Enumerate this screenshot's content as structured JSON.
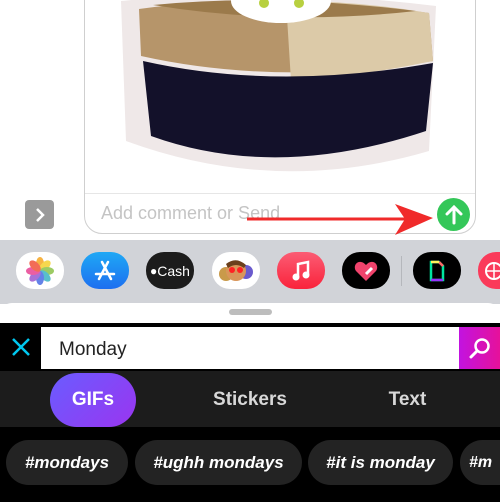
{
  "compose": {
    "placeholder": "Add comment or Send"
  },
  "app_drawer": {
    "items": [
      {
        "name": "Photos",
        "icon": "photos-icon"
      },
      {
        "name": "App Store",
        "icon": "app-store-icon"
      },
      {
        "name": "Cash",
        "label": "Cash",
        "icon": "apple-cash-icon"
      },
      {
        "name": "Memoji",
        "icon": "memoji-icon"
      },
      {
        "name": "Music",
        "icon": "music-icon"
      },
      {
        "name": "Digital Touch",
        "icon": "heart-icon"
      },
      {
        "name": "GIPHY",
        "icon": "giphy-icon"
      },
      {
        "name": "Web",
        "icon": "globe-icon"
      }
    ]
  },
  "giphy": {
    "search_value": "Monday",
    "tabs": [
      {
        "label": "GIFs",
        "active": true
      },
      {
        "label": "Stickers"
      },
      {
        "label": "Text"
      }
    ],
    "suggestions": [
      "#mondays",
      "#ughh mondays",
      "#it is monday",
      "#m"
    ],
    "colors": {
      "search_button": "#d010c0",
      "active_tab": "#7a45f5",
      "close_icon": "#00c8f0"
    }
  },
  "send_color": "#34c759"
}
